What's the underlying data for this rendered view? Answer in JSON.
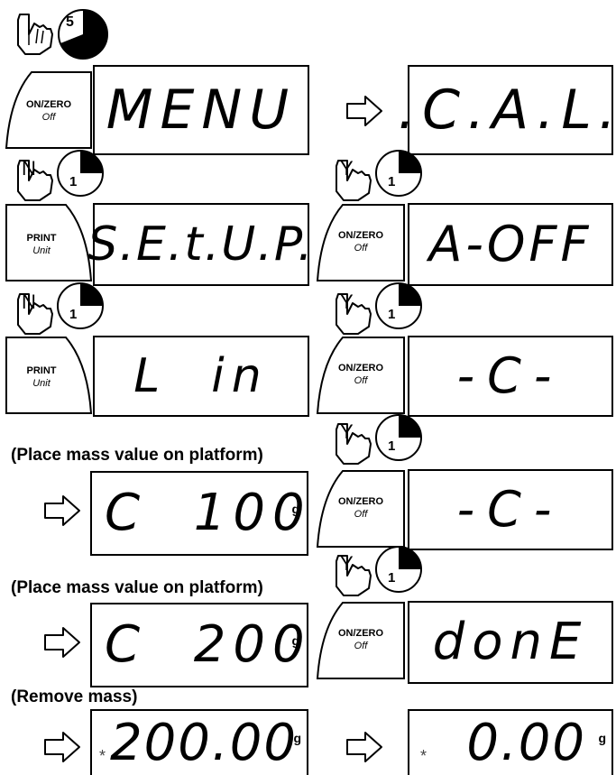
{
  "timer_steps": {
    "five": "5",
    "one": "1"
  },
  "hand_letters": {
    "no": "N",
    "yes": "Y"
  },
  "keys": {
    "on_zero": {
      "top": "ON/ZERO",
      "bottom": "Off"
    },
    "print": {
      "top": "PRINT",
      "bottom": "Unit"
    }
  },
  "displays": {
    "menu": "MENU",
    "cal": ".C.A.L.",
    "setup": "S.E.t.U.P.",
    "a_off": "A-OFF",
    "lin": "L  in",
    "c1": "-C-",
    "c100": "C  100",
    "c2": "-C-",
    "c200": "C  200",
    "done": "donE",
    "final1": "200.00",
    "final2": "0.00"
  },
  "unit_g": "g",
  "stable_star": "*",
  "notes": {
    "place1": "(Place mass value on platform)",
    "place2": "(Place mass value on platform)",
    "remove": "(Remove mass)"
  },
  "icons": [
    "hand-press-icon",
    "timer-icon",
    "arrow-right-icon"
  ]
}
